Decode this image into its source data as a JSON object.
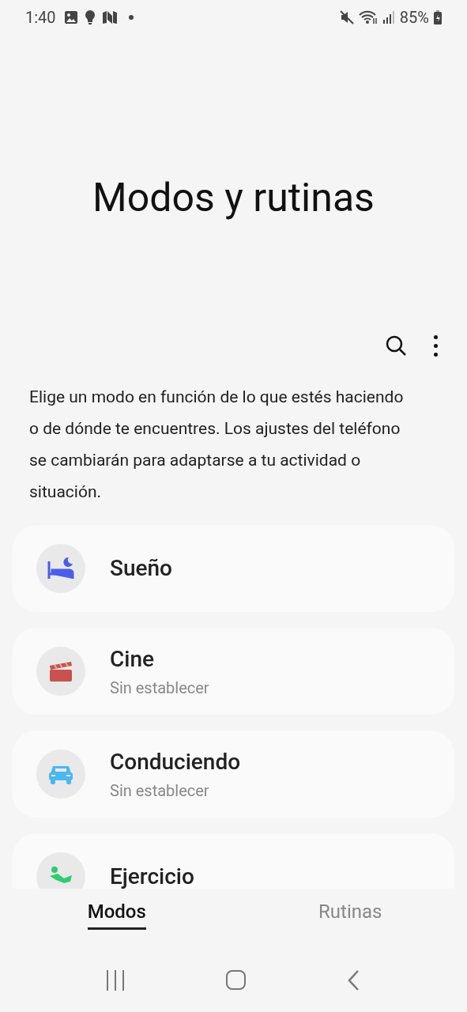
{
  "status_bar": {
    "time": "1:40",
    "battery": "85%"
  },
  "title": "Modos y rutinas",
  "description": "Elige un modo en función de lo que estés haciendo o de dónde te encuentres. Los ajustes del teléfono se cambiarán para adaptarse a tu actividad o situación.",
  "modes": [
    {
      "kind": "sleep",
      "name": "Sueño"
    },
    {
      "kind": "movie",
      "name": "Cine",
      "status": "Sin establecer"
    },
    {
      "kind": "driving",
      "name": "Conduciendo",
      "status": "Sin establecer"
    },
    {
      "kind": "exercise",
      "name": "Ejercicio"
    }
  ],
  "tabs": [
    {
      "label": "Modos",
      "selected": true
    },
    {
      "label": "Rutinas",
      "selected": false
    }
  ]
}
